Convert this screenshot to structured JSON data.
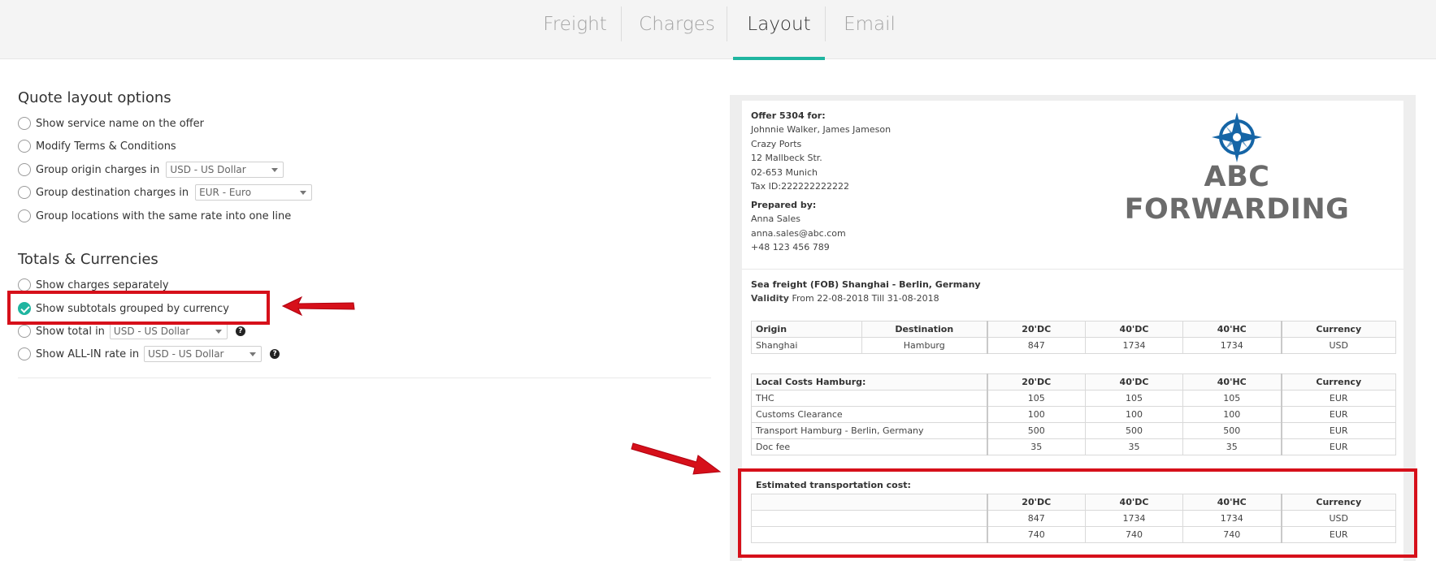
{
  "tabs": [
    {
      "label": "Freight",
      "active": false
    },
    {
      "label": "Charges",
      "active": false
    },
    {
      "label": "Layout",
      "active": true
    },
    {
      "label": "Email",
      "active": false
    }
  ],
  "layout_options": {
    "title": "Quote layout options",
    "items": [
      {
        "label": "Show service name on the offer"
      },
      {
        "label": "Modify Terms & Conditions"
      },
      {
        "label": "Group origin charges in",
        "select": "USD - US Dollar"
      },
      {
        "label": "Group destination charges in",
        "select": "EUR - Euro"
      },
      {
        "label": "Group locations with the same rate into one line"
      }
    ]
  },
  "totals": {
    "title": "Totals & Currencies",
    "items": [
      {
        "label": "Show charges separately",
        "checked": false
      },
      {
        "label": "Show subtotals grouped by currency",
        "checked": true
      },
      {
        "label": "Show total in",
        "select": "USD - US Dollar",
        "help": "?"
      },
      {
        "label": "Show ALL-IN rate in",
        "select": "USD - US Dollar",
        "help": "?"
      }
    ]
  },
  "offer": {
    "for_label": "Offer 5304 for:",
    "client": "Johnnie Walker, James Jameson",
    "company": "Crazy Ports",
    "street": "12 Mallbeck Str.",
    "city": "02-653 Munich",
    "tax": "Tax ID:222222222222",
    "prepared_label": "Prepared by:",
    "agent": "Anna Sales",
    "email": "anna.sales@abc.com",
    "phone": "+48 123 456 789",
    "brand": "ABC FORWARDING",
    "brand_icon": "compass-star-icon",
    "brand_color": "#1565a6",
    "freight": "Sea freight (FOB) Shanghai - Berlin, Germany",
    "validity_label": "Validity",
    "validity": "From 22-08-2018 Till 31-08-2018"
  },
  "freight_table": {
    "headers": [
      "Origin",
      "Destination",
      "20'DC",
      "40'DC",
      "40'HC",
      "Currency"
    ],
    "rows": [
      [
        "Shanghai",
        "Hamburg",
        "847",
        "1734",
        "1734",
        "USD"
      ]
    ]
  },
  "local_table": {
    "headers": [
      "Local Costs Hamburg:",
      "20'DC",
      "40'DC",
      "40'HC",
      "Currency"
    ],
    "rows": [
      [
        "THC",
        "105",
        "105",
        "105",
        "EUR"
      ],
      [
        "Customs Clearance",
        "100",
        "100",
        "100",
        "EUR"
      ],
      [
        "Transport Hamburg - Berlin, Germany",
        "500",
        "500",
        "500",
        "EUR"
      ],
      [
        "Doc fee",
        "35",
        "35",
        "35",
        "EUR"
      ]
    ]
  },
  "estimate": {
    "title": "Estimated transportation cost:",
    "headers": [
      "",
      "20'DC",
      "40'DC",
      "40'HC",
      "Currency"
    ],
    "rows": [
      [
        "",
        "847",
        "1734",
        "1734",
        "USD"
      ],
      [
        "",
        "740",
        "740",
        "740",
        "EUR"
      ]
    ]
  },
  "colors": {
    "accent": "#1fb5a0",
    "highlight": "#d6101a"
  }
}
